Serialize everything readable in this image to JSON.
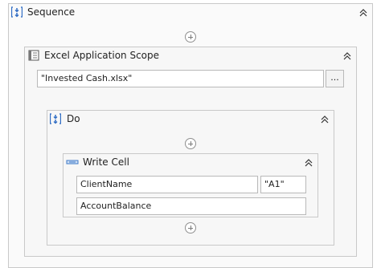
{
  "sequence": {
    "title": "Sequence",
    "icon": "sequence-icon",
    "collapse_icon": "chevron-double-up-icon"
  },
  "excel_scope": {
    "title": "Excel Application Scope",
    "icon": "excel-scope-icon",
    "file_path": "\"Invested Cash.xlsx\"",
    "browse_label": "..."
  },
  "do_block": {
    "title": "Do",
    "icon": "sequence-icon"
  },
  "write_cell": {
    "title": "Write Cell",
    "icon": "write-cell-icon",
    "sheet_name": "ClientName",
    "range": "\"A1\"",
    "value": "AccountBalance"
  }
}
